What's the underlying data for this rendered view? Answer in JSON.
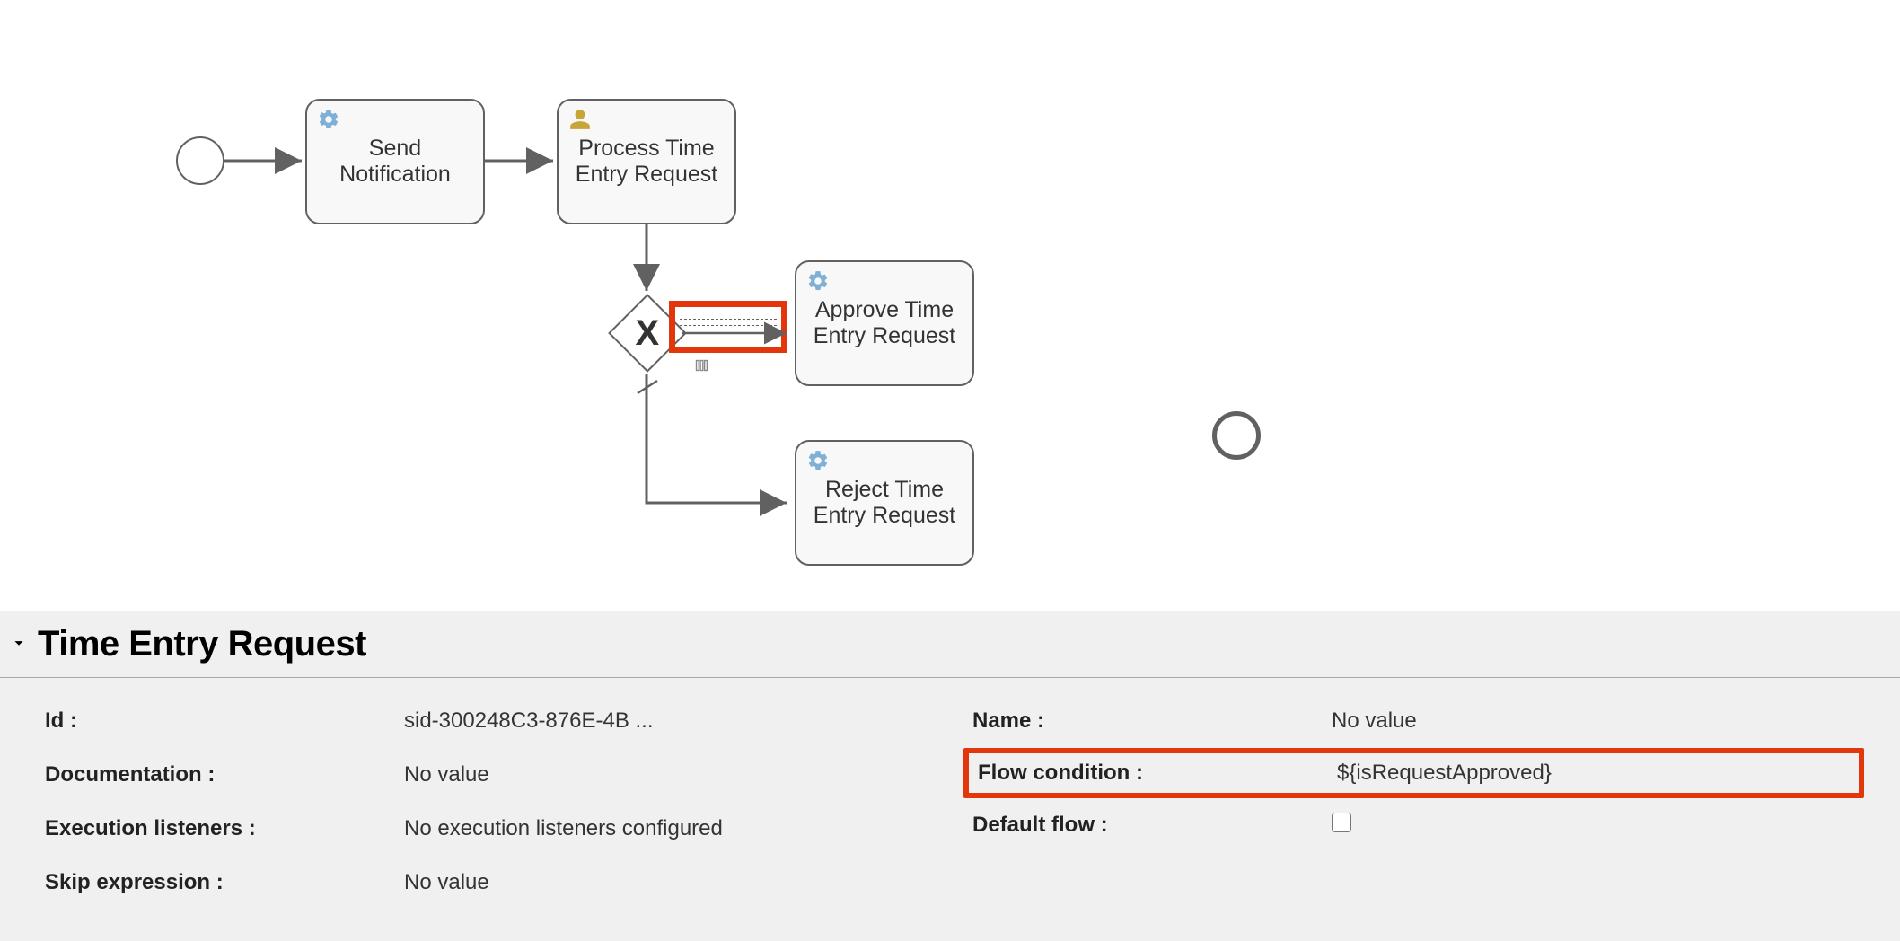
{
  "diagram": {
    "tasks": {
      "send_notification": "Send\nNotification",
      "process_time_entry": "Process Time\nEntry Request",
      "approve_time_entry": "Approve Time\nEntry Request",
      "reject_time_entry": "Reject Time\nEntry Request"
    },
    "gateway": {
      "label": "X"
    }
  },
  "panel": {
    "title": "Time Entry Request",
    "left": {
      "id_label": "Id :",
      "id_value": "sid-300248C3-876E-4B ...",
      "documentation_label": "Documentation :",
      "documentation_value": "No value",
      "execution_listeners_label": "Execution listeners :",
      "execution_listeners_value": "No execution listeners configured",
      "skip_expression_label": "Skip expression :",
      "skip_expression_value": "No value"
    },
    "right": {
      "name_label": "Name :",
      "name_value": "No value",
      "flow_condition_label": "Flow condition :",
      "flow_condition_value": "${isRequestApproved}",
      "default_flow_label": "Default flow :"
    }
  }
}
